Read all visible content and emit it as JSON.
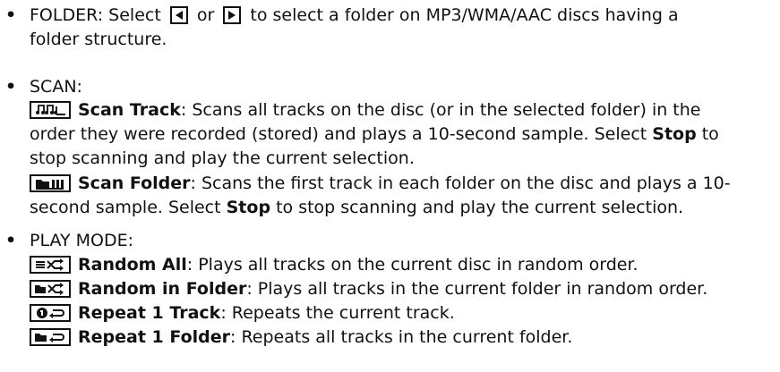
{
  "folder": {
    "label": "FOLDER",
    "text_a": ": Select ",
    "or": " or ",
    "text_b": " to select a folder on MP3/WMA/AAC discs having a",
    "text_c": "folder structure.",
    "left_icon": "left-arrow-icon",
    "right_icon": "right-arrow-icon"
  },
  "scan": {
    "label": "SCAN",
    "colon": ":",
    "track": {
      "icon": "scan-track-icon",
      "name": "Scan Track",
      "line1": ": Scans all tracks on the disc (or in the selected folder) in the",
      "line2": "order they were recorded (stored) and plays a 10-second sample. Select ",
      "stop": "Stop",
      "line2_end": " to",
      "line3": "stop scanning and play the current selection."
    },
    "folder": {
      "icon": "scan-folder-icon",
      "name": "Scan Folder",
      "line1": ": Scans the first track in each folder on the disc and plays a 10-",
      "line2a": "second sample. Select ",
      "stop": "Stop",
      "line2b": " to stop scanning and play the current selection."
    }
  },
  "play_mode": {
    "label": "PLAY MODE",
    "colon": ":",
    "items": [
      {
        "icon": "random-all-icon",
        "name": "Random All",
        "desc": ": Plays all tracks on the current disc in random order."
      },
      {
        "icon": "random-in-folder-icon",
        "name": "Random in Folder",
        "desc": ": Plays all tracks in the current folder in random order."
      },
      {
        "icon": "repeat-1-track-icon",
        "name": "Repeat 1 Track",
        "desc": ": Repeats the current track."
      },
      {
        "icon": "repeat-1-folder-icon",
        "name": "Repeat 1 Folder",
        "desc": ": Repeats all tracks in the current folder."
      }
    ]
  }
}
